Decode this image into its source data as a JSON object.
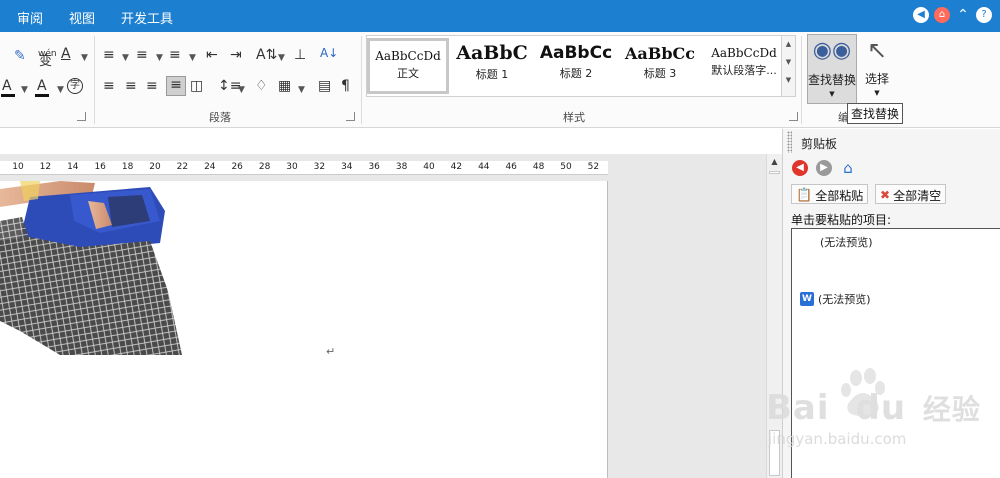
{
  "menu": {
    "tabs": [
      "审阅",
      "视图",
      "开发工具"
    ]
  },
  "window_buttons": [
    "back-circle",
    "home-circle",
    "collapse-arrow",
    "help-question"
  ],
  "ribbon": {
    "font_group": {
      "glyph_wen": "wén",
      "glyph_fu": "变",
      "glyph_a": "A",
      "glyph_zi": "字"
    },
    "paragraph_group": {
      "label": "段落",
      "sort_glyph": "A↓"
    },
    "styles_group": {
      "label": "样式",
      "items": [
        {
          "sample": "AaBbCcDd",
          "name": "正文"
        },
        {
          "sample": "AaBbC",
          "name": "标题 1"
        },
        {
          "sample": "AaBbCc",
          "name": "标题 2"
        },
        {
          "sample": "AaBbCc",
          "name": "标题 3"
        },
        {
          "sample": "AaBbCcDd",
          "name": "默认段落字..."
        }
      ]
    },
    "editing_group": {
      "label": "编",
      "find_replace": "查找替换",
      "select": "选择"
    },
    "tooltip": "查找替换"
  },
  "ruler": {
    "ticks": [
      "10",
      "12",
      "14",
      "16",
      "18",
      "20",
      "22",
      "24",
      "26",
      "28",
      "30",
      "32",
      "34",
      "36",
      "38",
      "40",
      "42",
      "44",
      "46",
      "48",
      "50",
      "52"
    ]
  },
  "document": {
    "paragraph_mark": "↵"
  },
  "clipboard_pane": {
    "title": "剪贴板",
    "paste_all": "全部粘贴",
    "clear_all": "全部清空",
    "items_label": "单击要粘贴的项目:",
    "items": [
      {
        "text": "(无法预览)",
        "has_icon": false
      },
      {
        "text": "(无法预览)",
        "has_icon": true
      }
    ]
  },
  "watermark": {
    "brand": "Bai",
    "brand2": "du",
    "cn": "经验",
    "url": "jingyan.baidu.com"
  },
  "colors": {
    "menubar": "#1d7fd0",
    "back_icon": "#e0352b",
    "forward_icon": "#9a9a9a",
    "home_icon": "#2a73c9"
  }
}
